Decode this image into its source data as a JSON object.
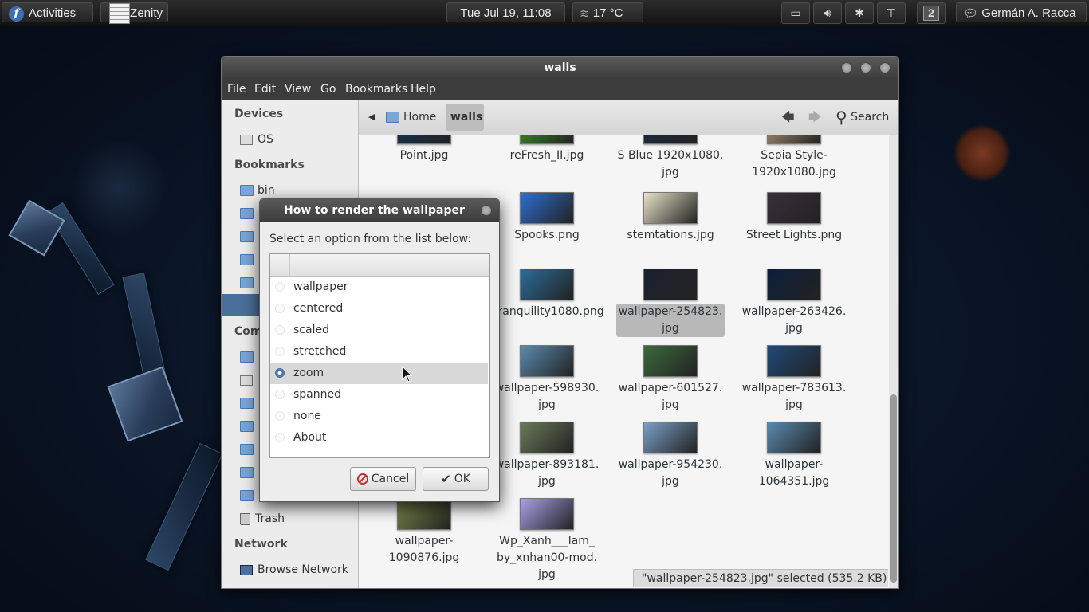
{
  "top_panel": {
    "activities_label": "Activities",
    "app_label": "Zenity",
    "clock": "Tue Jul 19, 11:08",
    "weather": "17 °C",
    "workspace": "2",
    "user": "Germán A. Racca",
    "tray_icons": [
      "folder-icon",
      "volume-icon",
      "bluetooth-icon",
      "network-icon"
    ]
  },
  "file_manager": {
    "title": "walls",
    "menu": [
      "File",
      "Edit",
      "View",
      "Go",
      "Bookmarks",
      "Help"
    ],
    "sidebar": {
      "devices_heading": "Devices",
      "devices": [
        "OS"
      ],
      "bookmarks_heading": "Bookmarks",
      "bookmarks": [
        "bin"
      ],
      "computer_heading": "Com",
      "trash": "Trash",
      "network_heading": "Network",
      "network_items": [
        "Browse Network"
      ]
    },
    "breadcrumbs": [
      "Home",
      "walls"
    ],
    "search_label": "Search",
    "files": [
      {
        "name": "Point.jpg",
        "color": "#123456"
      },
      {
        "name": "reFresh_II.jpg",
        "color": "#3c9a2a"
      },
      {
        "name": "S Blue 1920x1080.\njpg",
        "color": "#1a2a44"
      },
      {
        "name": "Sepia Style-\n1920x1080.jpg",
        "color": "#b89a7a"
      },
      {
        "name": "Spooks.png",
        "color": "#2e6fd0"
      },
      {
        "name": "stemtations.jpg",
        "color": "#e8e4c8"
      },
      {
        "name": "Street Lights.png",
        "color": "#3a2e3a"
      },
      {
        "name": "Tranquility1080.png",
        "color": "#2b6d9a"
      },
      {
        "name": "wallpaper-254823.\njpg",
        "color": "#1b2130"
      },
      {
        "name": "wallpaper-263426.\njpg",
        "color": "#0d1f3a"
      },
      {
        "name": "wallpaper-598930.\njpg",
        "color": "#5a8bb0"
      },
      {
        "name": "wallpaper-601527.\njpg",
        "color": "#3a6a3a"
      },
      {
        "name": "wallpaper-783613.\njpg",
        "color": "#1f4a7a"
      },
      {
        "name": "wallpaper-893181.\njpg",
        "color": "#6a7a5a"
      },
      {
        "name": "wallpaper-954230.\njpg",
        "color": "#7aa0c8"
      },
      {
        "name": "wallpaper-\n1064351.jpg",
        "color": "#5a8ab0"
      },
      {
        "name": "wallpaper-\n1090876.jpg",
        "color": "#7a8a4a"
      },
      {
        "name": "Wp_Xanh___lam_\nby_xnhan00-mod.\njpg",
        "color": "#a8a0e8"
      }
    ],
    "status": "\"wallpaper-254823.jpg\" selected (535.2 KB)"
  },
  "dialog": {
    "title": "How to render the wallpaper",
    "prompt": "Select an option from the list below:",
    "options": [
      "wallpaper",
      "centered",
      "scaled",
      "stretched",
      "zoom",
      "spanned",
      "none",
      "About"
    ],
    "selected": "zoom",
    "cancel_label": "Cancel",
    "ok_label": "OK"
  },
  "colors": {
    "selection_blue": "#4a6f9b",
    "cancel_red": "#c4302b",
    "panel_bg": "#1e1e1e"
  }
}
